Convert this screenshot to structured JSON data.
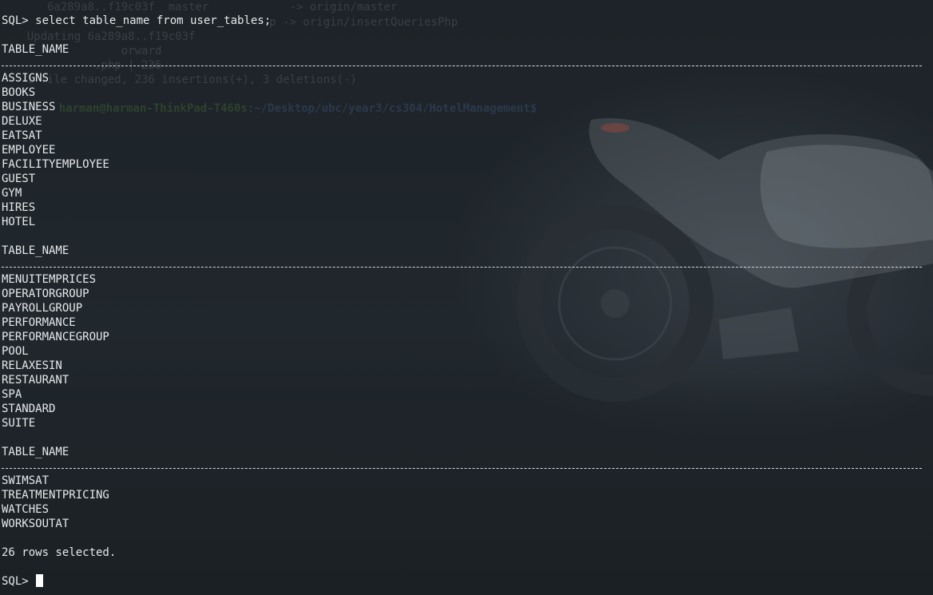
{
  "terminal": {
    "command": "SQL> select table_name from user_tables;",
    "column_header": "TABLE_NAME",
    "groups": [
      [
        "ASSIGNS",
        "BOOKS",
        "BUSINESS",
        "DELUXE",
        "EATSAT",
        "EMPLOYEE",
        "FACILITYEMPLOYEE",
        "GUEST",
        "GYM",
        "HIRES",
        "HOTEL"
      ],
      [
        "MENUITEMPRICES",
        "OPERATORGROUP",
        "PAYROLLGROUP",
        "PERFORMANCE",
        "PERFORMANCEGROUP",
        "POOL",
        "RELAXESIN",
        "RESTAURANT",
        "SPA",
        "STANDARD",
        "SUITE"
      ],
      [
        "SWIMSAT",
        "TREATMENTPRICING",
        "WATCHES",
        "WORKSOUTAT"
      ]
    ],
    "result_summary": "26 rows selected.",
    "final_prompt": "SQL>"
  },
  "background_ghost": {
    "lines": [
      "       6a289a8..f19c03f  master            -> origin/master",
      "                                        p -> origin/insertQueriesPhp",
      "    Updating 6a289a8..f19c03f",
      "                  orward",
      "              .php | 236",
      "    1 file changed, 236 insertions(+), 3 deletions(-)"
    ],
    "prompt_user": "harman@harman-ThinkPad-T460s",
    "prompt_path": ":~/Desktop/ubc/year3/cs304/HotelManagement$"
  },
  "colors": {
    "background": "#1c2227",
    "text": "#e6e9ea",
    "cursor": "#ffffff"
  }
}
